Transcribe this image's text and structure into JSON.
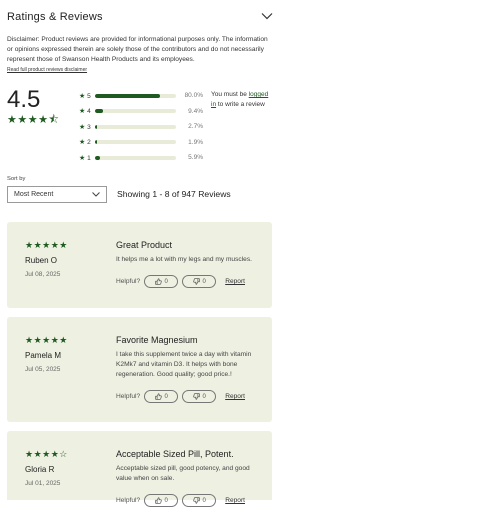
{
  "header": {
    "title": "Ratings & Reviews"
  },
  "disclaimer": {
    "text": "Disclaimer: Product reviews are provided for informational purposes only. The information or opinions expressed therein are solely those of the contributors and do not necessarily represent those of Swanson Health Products and its employees.",
    "link": "Read full product reviews disclaimer"
  },
  "summary": {
    "average": "4.5",
    "average_stars": "★★★★⯪",
    "distribution": [
      {
        "label": "5",
        "star": "★",
        "pct_text": "80.0%",
        "pct": 80.0
      },
      {
        "label": "4",
        "star": "★",
        "pct_text": "9.4%",
        "pct": 9.4
      },
      {
        "label": "3",
        "star": "★",
        "pct_text": "2.7%",
        "pct": 2.7
      },
      {
        "label": "2",
        "star": "★",
        "pct_text": "1.9%",
        "pct": 1.9
      },
      {
        "label": "1",
        "star": "★",
        "pct_text": "5.9%",
        "pct": 5.9
      }
    ]
  },
  "login_prompt": {
    "prefix": "You must be ",
    "link": "logged in",
    "suffix": " to write a review"
  },
  "sort": {
    "label": "Sort by",
    "value": "Most Recent"
  },
  "showing": "Showing 1 - 8 of 947 Reviews",
  "reviews": [
    {
      "stars": "★★★★★",
      "name": "Ruben O",
      "date": "Jul 08, 2025",
      "title": "Great Product",
      "body": "It helps me a lot with my legs and my muscles.",
      "helpful_label": "Helpful?",
      "up": "0",
      "down": "0",
      "report": "Report"
    },
    {
      "stars": "★★★★★",
      "name": "Pamela M",
      "date": "Jul 05, 2025",
      "title": "Favorite Magnesium",
      "body": "I take this supplement twice a day with vitamin K2Mk7 and vitamin D3. It helps with bone regeneration. Good quality; good price.!",
      "helpful_label": "Helpful?",
      "up": "0",
      "down": "0",
      "report": "Report"
    },
    {
      "stars": "★★★★☆",
      "name": "Gloria R",
      "date": "Jul 01, 2025",
      "title": "Acceptable Sized Pill, Potent.",
      "body": "Acceptable sized pill, good potency, and good value when on sale.",
      "helpful_label": "Helpful?",
      "up": "0",
      "down": "0",
      "report": "Report"
    }
  ],
  "icons": {
    "collapse": "chevron-down-icon",
    "select": "chevron-down-icon",
    "thumbs_up": "thumbs-up-icon",
    "thumbs_down": "thumbs-down-icon"
  },
  "colors": {
    "accent": "#1f5a21",
    "card_bg": "#eef0e2",
    "bar_track": "#e9ebd9"
  }
}
